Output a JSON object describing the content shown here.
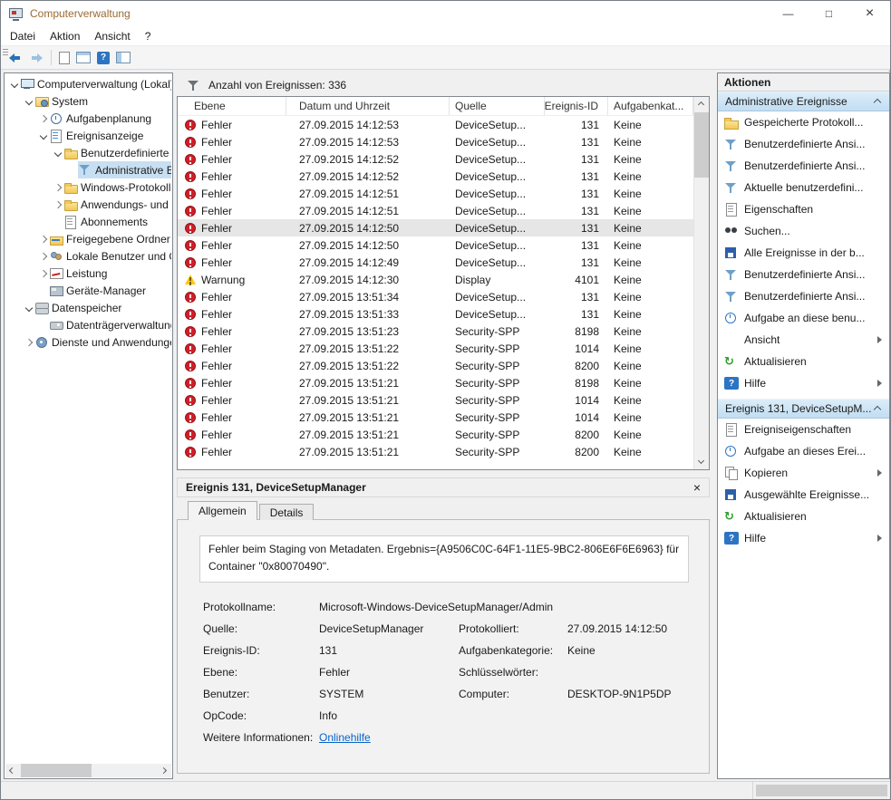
{
  "window": {
    "title": "Computerverwaltung",
    "minimize_glyph": "—",
    "maximize_glyph": "□",
    "close_glyph": "×"
  },
  "menubar": {
    "items": [
      "Datei",
      "Aktion",
      "Ansicht",
      "?"
    ]
  },
  "tree": {
    "items": [
      {
        "label": "Computerverwaltung (Lokal)"
      },
      {
        "label": "System"
      },
      {
        "label": "Aufgabenplanung"
      },
      {
        "label": "Ereignisanzeige"
      },
      {
        "label": "Benutzerdefinierte A"
      },
      {
        "label": "Administrative E"
      },
      {
        "label": "Windows-Protokolle"
      },
      {
        "label": "Anwendungs- und D"
      },
      {
        "label": "Abonnements"
      },
      {
        "label": "Freigegebene Ordner"
      },
      {
        "label": "Lokale Benutzer und Gr"
      },
      {
        "label": "Leistung"
      },
      {
        "label": "Geräte-Manager"
      },
      {
        "label": "Datenspeicher"
      },
      {
        "label": "Datenträgerverwaltung"
      },
      {
        "label": "Dienste und Anwendungen"
      }
    ]
  },
  "events": {
    "count_label": "Anzahl von Ereignissen: 336",
    "columns": {
      "level": "Ebene",
      "datetime": "Datum und Uhrzeit",
      "source": "Quelle",
      "event_id": "Ereignis-ID",
      "category": "Aufgabenkat..."
    },
    "rows": [
      {
        "level": "Fehler",
        "datetime": "27.09.2015 14:12:53",
        "source": "DeviceSetup...",
        "event_id": "131",
        "category": "Keine"
      },
      {
        "level": "Fehler",
        "datetime": "27.09.2015 14:12:53",
        "source": "DeviceSetup...",
        "event_id": "131",
        "category": "Keine"
      },
      {
        "level": "Fehler",
        "datetime": "27.09.2015 14:12:52",
        "source": "DeviceSetup...",
        "event_id": "131",
        "category": "Keine"
      },
      {
        "level": "Fehler",
        "datetime": "27.09.2015 14:12:52",
        "source": "DeviceSetup...",
        "event_id": "131",
        "category": "Keine"
      },
      {
        "level": "Fehler",
        "datetime": "27.09.2015 14:12:51",
        "source": "DeviceSetup...",
        "event_id": "131",
        "category": "Keine"
      },
      {
        "level": "Fehler",
        "datetime": "27.09.2015 14:12:51",
        "source": "DeviceSetup...",
        "event_id": "131",
        "category": "Keine"
      },
      {
        "level": "Fehler",
        "datetime": "27.09.2015 14:12:50",
        "source": "DeviceSetup...",
        "event_id": "131",
        "category": "Keine"
      },
      {
        "level": "Fehler",
        "datetime": "27.09.2015 14:12:50",
        "source": "DeviceSetup...",
        "event_id": "131",
        "category": "Keine"
      },
      {
        "level": "Fehler",
        "datetime": "27.09.2015 14:12:49",
        "source": "DeviceSetup...",
        "event_id": "131",
        "category": "Keine"
      },
      {
        "level": "Warnung",
        "datetime": "27.09.2015 14:12:30",
        "source": "Display",
        "event_id": "4101",
        "category": "Keine"
      },
      {
        "level": "Fehler",
        "datetime": "27.09.2015 13:51:34",
        "source": "DeviceSetup...",
        "event_id": "131",
        "category": "Keine"
      },
      {
        "level": "Fehler",
        "datetime": "27.09.2015 13:51:33",
        "source": "DeviceSetup...",
        "event_id": "131",
        "category": "Keine"
      },
      {
        "level": "Fehler",
        "datetime": "27.09.2015 13:51:23",
        "source": "Security-SPP",
        "event_id": "8198",
        "category": "Keine"
      },
      {
        "level": "Fehler",
        "datetime": "27.09.2015 13:51:22",
        "source": "Security-SPP",
        "event_id": "1014",
        "category": "Keine"
      },
      {
        "level": "Fehler",
        "datetime": "27.09.2015 13:51:22",
        "source": "Security-SPP",
        "event_id": "8200",
        "category": "Keine"
      },
      {
        "level": "Fehler",
        "datetime": "27.09.2015 13:51:21",
        "source": "Security-SPP",
        "event_id": "8198",
        "category": "Keine"
      },
      {
        "level": "Fehler",
        "datetime": "27.09.2015 13:51:21",
        "source": "Security-SPP",
        "event_id": "1014",
        "category": "Keine"
      },
      {
        "level": "Fehler",
        "datetime": "27.09.2015 13:51:21",
        "source": "Security-SPP",
        "event_id": "1014",
        "category": "Keine"
      },
      {
        "level": "Fehler",
        "datetime": "27.09.2015 13:51:21",
        "source": "Security-SPP",
        "event_id": "8200",
        "category": "Keine"
      },
      {
        "level": "Fehler",
        "datetime": "27.09.2015 13:51:21",
        "source": "Security-SPP",
        "event_id": "8200",
        "category": "Keine"
      }
    ]
  },
  "details": {
    "title": "Ereignis 131, DeviceSetupManager",
    "close_glyph": "×",
    "tab_allgemein": "Allgemein",
    "tab_details": "Details",
    "description": "Fehler beim Staging von Metadaten. Ergebnis={A9506C0C-64F1-11E5-9BC2-806E6F6E6963} für Container \"0x80070490\".",
    "f": {
      "protokollname_label": "Protokollname:",
      "protokollname": "Microsoft-Windows-DeviceSetupManager/Admin",
      "quelle_label": "Quelle:",
      "quelle": "DeviceSetupManager",
      "protokolliert_label": "Protokolliert:",
      "protokolliert": "27.09.2015 14:12:50",
      "ereignis_id_label": "Ereignis-ID:",
      "ereignis_id": "131",
      "aufgabenkategorie_label": "Aufgabenkategorie:",
      "aufgabenkategorie": "Keine",
      "ebene_label": "Ebene:",
      "ebene": "Fehler",
      "schluesselwoerter_label": "Schlüsselwörter:",
      "schluesselwoerter": "",
      "benutzer_label": "Benutzer:",
      "benutzer": "SYSTEM",
      "computer_label": "Computer:",
      "computer": "DESKTOP-9N1P5DP",
      "opcode_label": "OpCode:",
      "opcode": "Info",
      "weitere_label": "Weitere Informationen:",
      "weitere_link": "Onlinehilfe"
    }
  },
  "actions": {
    "title": "Aktionen",
    "sections": [
      {
        "title": "Administrative Ereignisse",
        "items": [
          {
            "label": "Gespeicherte Protokoll..."
          },
          {
            "label": "Benutzerdefinierte Ansi..."
          },
          {
            "label": "Benutzerdefinierte Ansi..."
          },
          {
            "label": "Aktuelle benutzerdefini..."
          },
          {
            "label": "Eigenschaften"
          },
          {
            "label": "Suchen..."
          },
          {
            "label": "Alle Ereignisse in der b..."
          },
          {
            "label": "Benutzerdefinierte Ansi..."
          },
          {
            "label": "Benutzerdefinierte Ansi..."
          },
          {
            "label": "Aufgabe an diese benu..."
          },
          {
            "label": "Ansicht"
          },
          {
            "label": "Aktualisieren"
          },
          {
            "label": "Hilfe"
          }
        ]
      },
      {
        "title": "Ereignis 131, DeviceSetupM...",
        "items": [
          {
            "label": "Ereigniseigenschaften"
          },
          {
            "label": "Aufgabe an dieses Erei..."
          },
          {
            "label": "Kopieren"
          },
          {
            "label": "Ausgewählte Ereignisse..."
          },
          {
            "label": "Aktualisieren"
          },
          {
            "label": "Hilfe"
          }
        ]
      }
    ]
  }
}
